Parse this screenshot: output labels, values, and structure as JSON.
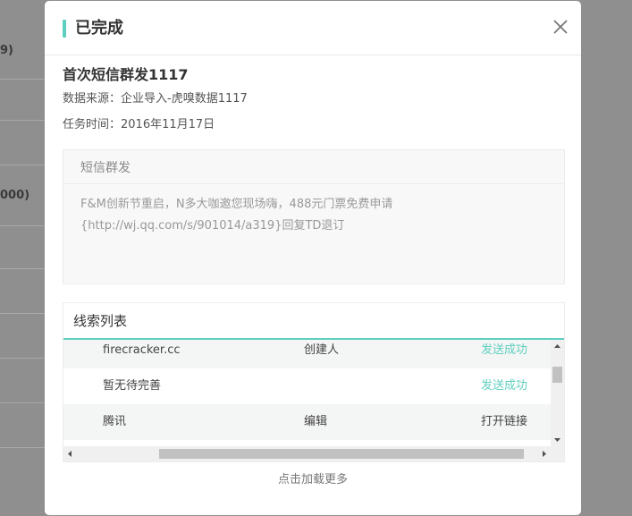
{
  "background": {
    "fragment_1": "9)",
    "fragment_2": "000)"
  },
  "modal": {
    "title": "已完成",
    "close_icon": "close-icon",
    "task_title": "首次短信群发1117",
    "data_source": "数据来源：企业导入-虎嗅数据1117",
    "task_time": "任务时间：2016年11月17日"
  },
  "sms": {
    "title": "短信群发",
    "content_line1": "F&M创新节重启，N多大咖邀您现场嗨，488元门票免费申请",
    "content_line2": "{http://wj.qq.com/s/901014/a319}回复TD退订"
  },
  "leads": {
    "title": "线索列表",
    "rows": [
      {
        "name": "firecracker.cc",
        "role": "创建人",
        "status": "发送成功",
        "status_type": "success"
      },
      {
        "name": "暂无待完善",
        "role": "",
        "status": "发送成功",
        "status_type": "success"
      },
      {
        "name": "腾讯",
        "role": "编辑",
        "status": "打开链接",
        "status_type": "normal"
      }
    ],
    "vertical_scroll_position": 0.25,
    "horizontal_scroll_position": 0.5
  },
  "footer": {
    "load_more": "点击加载更多"
  },
  "colors": {
    "accent": "#5fcfbf",
    "overlay": "#8f8f8f"
  }
}
